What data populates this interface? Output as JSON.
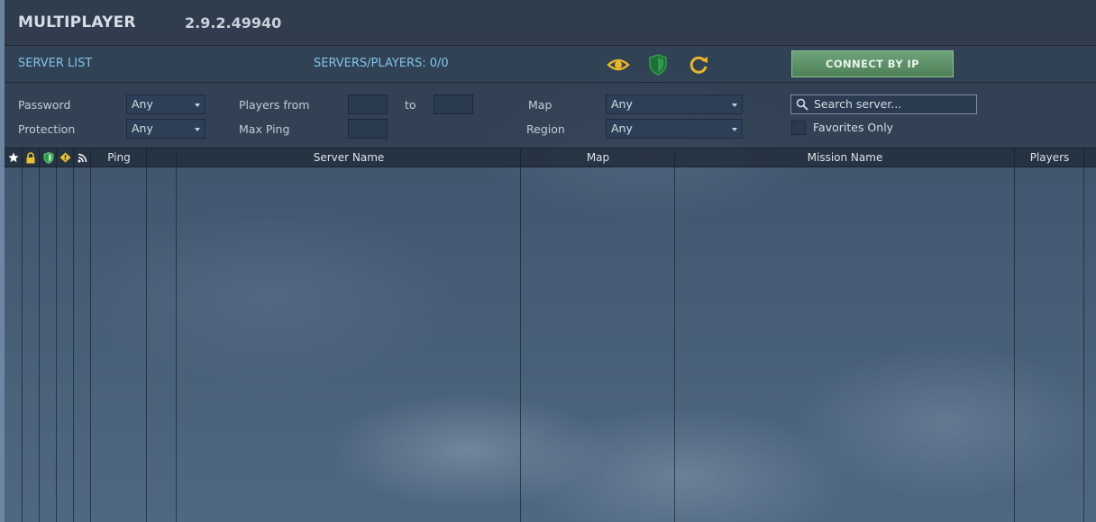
{
  "header": {
    "title": "MULTIPLAYER",
    "version": "2.9.2.49940"
  },
  "subbar": {
    "server_list_label": "SERVER LIST",
    "servers_players": "SERVERS/PLAYERS: 0/0",
    "connect_label": "CONNECT BY IP"
  },
  "filters": {
    "password_label": "Password",
    "password_value": "Any",
    "protection_label": "Protection",
    "protection_value": "Any",
    "players_from_label": "Players from",
    "to_label": "to",
    "max_ping_label": "Max Ping",
    "map_label": "Map",
    "map_value": "Any",
    "region_label": "Region",
    "region_value": "Any",
    "search_placeholder": "Search server...",
    "favorites_label": "Favorites Only"
  },
  "table": {
    "columns": [
      "Ping",
      "Server Name",
      "Map",
      "Mission Name",
      "Players"
    ]
  },
  "icons": {
    "favorite": "star-icon",
    "password": "lock-icon",
    "protection": "shield-icon",
    "warning": "warning-icon",
    "connection": "signal-icon",
    "view": "eye-icon",
    "protect_toggle": "shield-icon",
    "refresh": "refresh-icon",
    "search": "search-icon"
  },
  "colors": {
    "accent_link": "#7fc4e8",
    "connect_green": "#5c9066",
    "icon_yellow": "#e8b62b",
    "shield_green": "#2f9a4a"
  }
}
